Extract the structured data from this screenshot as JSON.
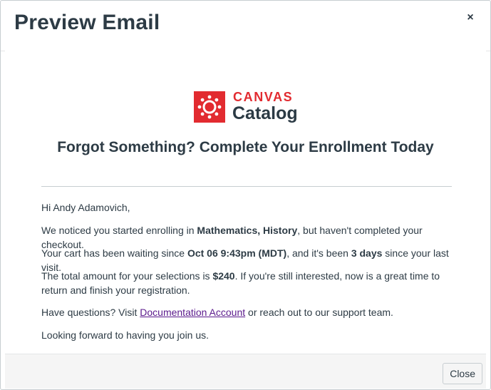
{
  "modal": {
    "title": "Preview Email",
    "close_icon": "close-icon",
    "close_glyph": "×"
  },
  "email": {
    "logo": {
      "brand_top": "CANVAS",
      "brand_bottom": "Catalog",
      "brand_color": "#e22b30"
    },
    "heading": "Forgot Something? Complete Your Enrollment Today",
    "greeting": "Hi Andy Adamovich,",
    "p1": {
      "pre": "We noticed you started enrolling in ",
      "courses": "Mathematics, History",
      "post": ", but haven't completed your checkout."
    },
    "p2": {
      "pre": "Your cart has been waiting since ",
      "since": "Oct 06 9:43pm (MDT)",
      "mid": ", and it's been ",
      "days": "3 days",
      "post": " since your last visit."
    },
    "p3": {
      "pre": "The total amount for your selections is ",
      "amount": "$240",
      "post": ". If you're still interested, now is a great time to return and finish your registration."
    },
    "p4": {
      "pre": "Have questions? Visit ",
      "link": "Documentation Account",
      "post": " or reach out to our support team."
    },
    "p5": "Looking forward to having you join us."
  },
  "footer": {
    "close_label": "Close"
  },
  "colors": {
    "text": "#2d3b45",
    "link": "#5b1a8c",
    "footer_bg": "#f5f5f5"
  }
}
